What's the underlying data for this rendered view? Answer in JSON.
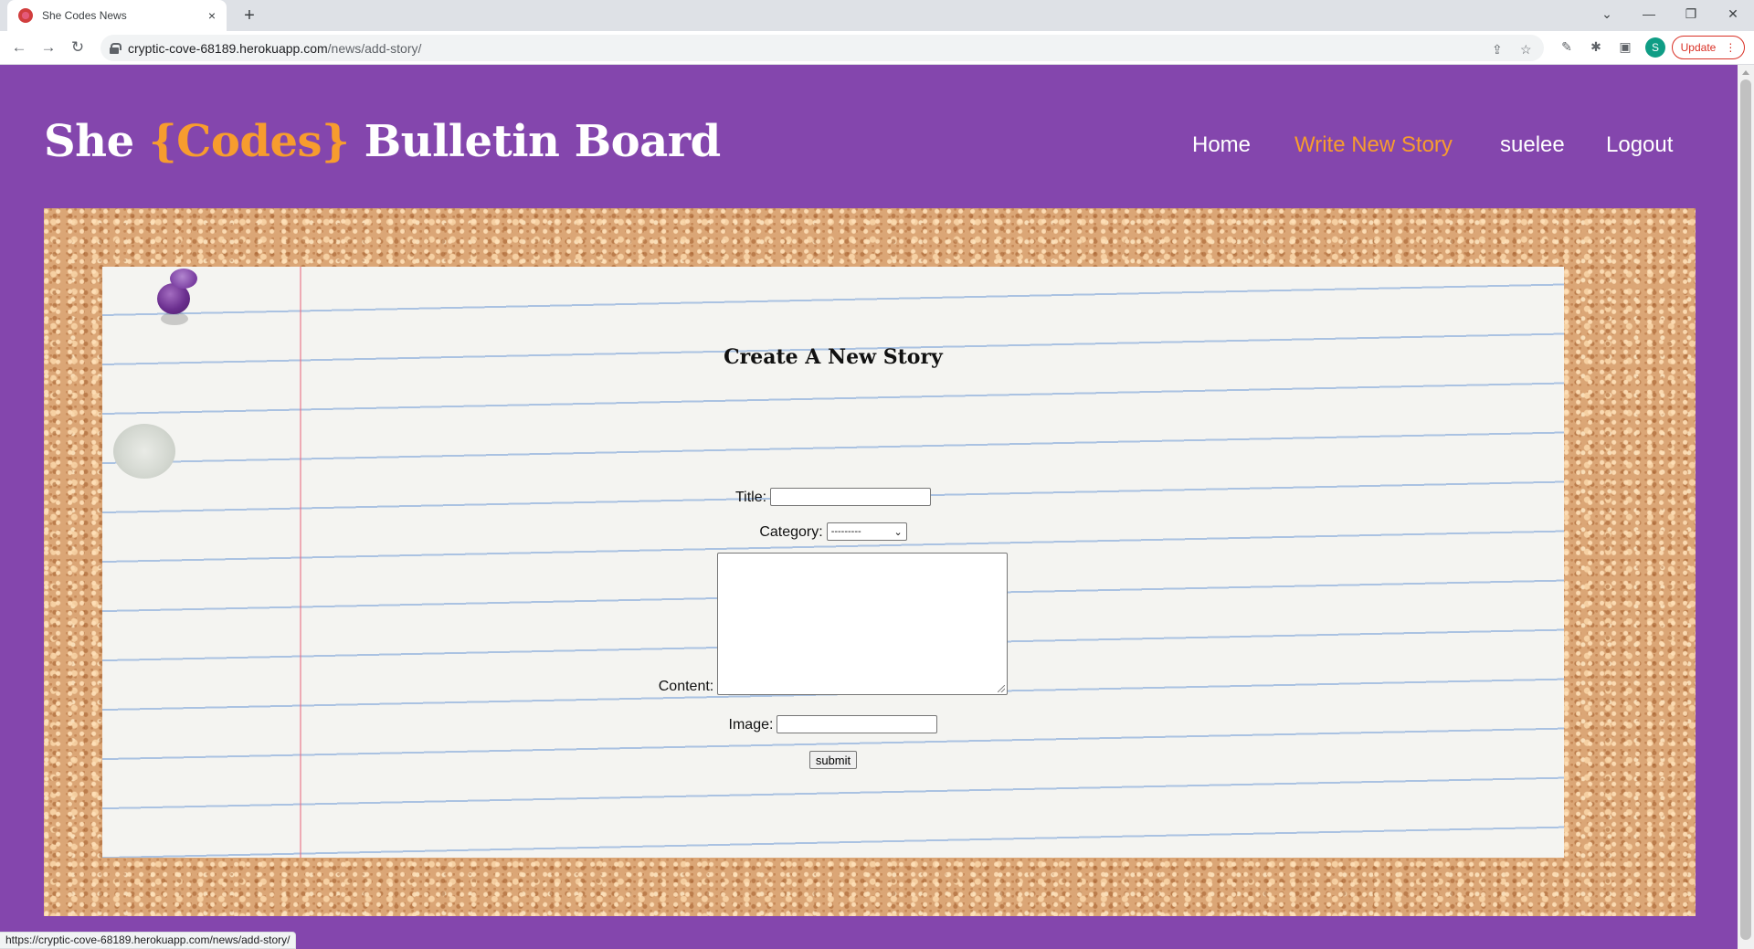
{
  "browser": {
    "tab_title": "She Codes News",
    "tab_close": "×",
    "new_tab": "+",
    "url_host": "cryptic-cove-68189.herokuapp.com",
    "url_path": "/news/add-story/",
    "profile_initial": "S",
    "update_label": "Update",
    "status_url": "https://cryptic-cove-68189.herokuapp.com/news/add-story/"
  },
  "site": {
    "title_pre": "She ",
    "title_accent": "{Codes}",
    "title_post": " Bulletin Board",
    "accent_color": "#f79c2e",
    "background_color": "#8446ad"
  },
  "nav": {
    "home": "Home",
    "write": "Write New Story",
    "user": "suelee",
    "logout": "Logout"
  },
  "form": {
    "heading": "Create A New Story",
    "title_label": "Title:",
    "category_label": "Category:",
    "category_value": "---------",
    "content_label": "Content:",
    "image_label": "Image:",
    "submit_label": "submit"
  }
}
